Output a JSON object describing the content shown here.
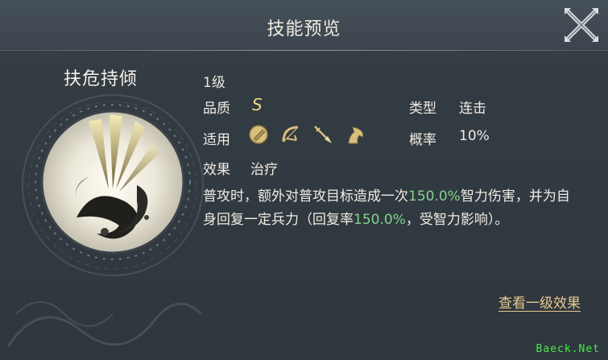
{
  "header": {
    "title": "技能预览"
  },
  "skill": {
    "name": "扶危持倾",
    "level": "1级",
    "quality_label": "品质",
    "quality_value": "S",
    "type_label": "类型",
    "type_value": "连击",
    "applies_label": "适用",
    "applies_icons": [
      "shield-icon",
      "bow-icon",
      "spear-icon",
      "horse-icon"
    ],
    "rate_label": "概率",
    "rate_value": "10%",
    "effect_label": "效果",
    "effect_value": "治疗",
    "description": {
      "p1": "普攻时，额外对普攻目标造成一次",
      "v1": "150.0%",
      "p2": "智力伤害，并为自身回复一定兵力（回复率",
      "v2": "150.0%",
      "p3": "，受智力影响）。"
    },
    "detail_link": "查看一级效果"
  },
  "watermark": "Baeck.Net",
  "colors": {
    "highlight": "#7fd58a",
    "link": "#e7c98f",
    "quality": "#f1d78c"
  }
}
